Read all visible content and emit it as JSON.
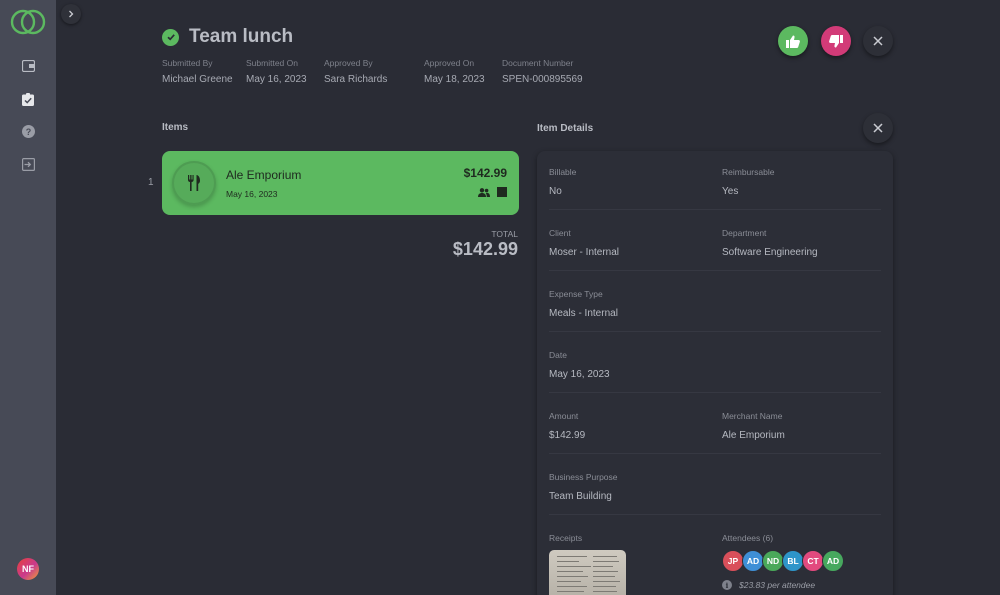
{
  "header": {
    "title": "Team lunch",
    "meta": [
      {
        "label": "Submitted By",
        "value": "Michael Greene"
      },
      {
        "label": "Submitted On",
        "value": "May 16, 2023"
      },
      {
        "label": "Approved By",
        "value": "Sara Richards"
      },
      {
        "label": "Approved On",
        "value": "May 18, 2023"
      },
      {
        "label": "Document Number",
        "value": "SPEN-000895569"
      }
    ]
  },
  "sidebar": {
    "items": [
      {
        "icon": "wallet-icon"
      },
      {
        "icon": "approvals-icon"
      },
      {
        "icon": "help-icon"
      },
      {
        "icon": "logout-icon"
      }
    ],
    "user_initials": "NF"
  },
  "items_section": {
    "title": "Items",
    "items": [
      {
        "index": "1",
        "merchant": "Ale Emporium",
        "date": "May 16, 2023",
        "amount": "$142.99",
        "icon": "fork-knife-icon"
      }
    ],
    "total_label": "TOTAL",
    "total_value": "$142.99"
  },
  "details": {
    "title": "Item Details",
    "billable": {
      "label": "Billable",
      "value": "No"
    },
    "reimbursable": {
      "label": "Reimbursable",
      "value": "Yes"
    },
    "client": {
      "label": "Client",
      "value": "Moser - Internal"
    },
    "department": {
      "label": "Department",
      "value": "Software Engineering"
    },
    "expense_type": {
      "label": "Expense Type",
      "value": "Meals - Internal"
    },
    "date": {
      "label": "Date",
      "value": "May 16, 2023"
    },
    "amount": {
      "label": "Amount",
      "value": "$142.99"
    },
    "merchant_name": {
      "label": "Merchant Name",
      "value": "Ale Emporium"
    },
    "business_purpose": {
      "label": "Business Purpose",
      "value": "Team Building"
    },
    "receipts_label": "Receipts",
    "attendees_label": "Attendees (6)",
    "attendees": [
      {
        "initials": "JP",
        "color": "#d94f5a"
      },
      {
        "initials": "AD",
        "color": "#3f8fd6"
      },
      {
        "initials": "ND",
        "color": "#4aa85a"
      },
      {
        "initials": "BL",
        "color": "#2e95c9"
      },
      {
        "initials": "CT",
        "color": "#e24a7e"
      },
      {
        "initials": "AD",
        "color": "#47a85e"
      }
    ],
    "per_attendee": "$23.83 per attendee"
  },
  "colors": {
    "accent_green": "#5cb960",
    "reject_pink": "#d23b78",
    "background": "#2a2c35",
    "sidebar": "#474a56"
  }
}
